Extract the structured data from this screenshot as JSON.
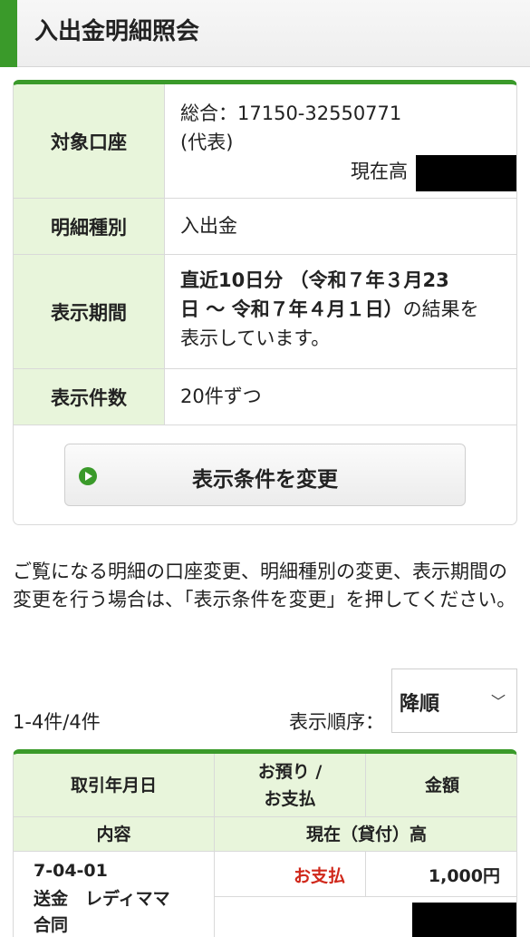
{
  "header": {
    "title": "入出金明細照会"
  },
  "conditions": {
    "account": {
      "label": "対象口座",
      "line1": "総合：17150-32550771",
      "line2": "(代表)",
      "balance_label": "現在高"
    },
    "detail_type": {
      "label": "明細種別",
      "value": "入出金"
    },
    "period": {
      "label": "表示期間",
      "line1_bold": "直近10日分 （令和７年３月23",
      "line2_bold": "日 〜 令和７年４月１日）",
      "line2_rest": "の結果を",
      "line3": "表示しています。"
    },
    "per_page": {
      "label": "表示件数",
      "value": "20件ずつ"
    },
    "change_button": "表示条件を変更"
  },
  "note": "ご覧になる明細の口座変更、明細種別の変更、表示期間の変更を行う場合は、「表示条件を変更」を押してください。",
  "result": {
    "count": "1-4件/4件",
    "order_label": "表示順序：",
    "order_value": "降順"
  },
  "table": {
    "headers": {
      "date": "取引年月日",
      "type_line1": "お預り /",
      "type_line2": "お支払",
      "amount": "金額",
      "content": "内容",
      "balance": "現在（貸付）高"
    },
    "rows": [
      {
        "date": "7-04-01",
        "desc_line1": "送金　レディママ",
        "desc_line2": "合同",
        "type": "お支払",
        "amount": "1,000円"
      }
    ]
  },
  "colors": {
    "accent": "#3a9a2a",
    "header_bg": "#e8f5db",
    "payment_red": "#d0281b"
  }
}
